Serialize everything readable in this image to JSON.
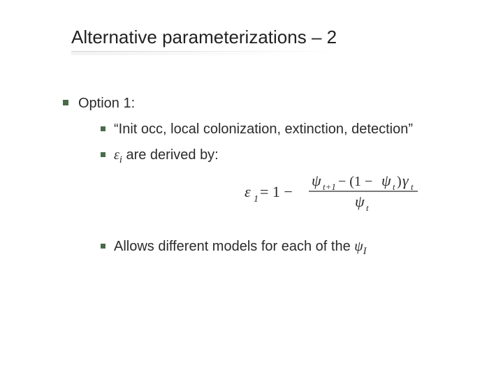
{
  "slide": {
    "title": "Alternative parameterizations – 2",
    "option": {
      "heading": "Option 1:",
      "sub1": "“Init occ, local colonization, extinction, detection”",
      "sub2_prefix": "ε",
      "sub2_sub": "i",
      "sub2_rest": " are derived by:",
      "sub3_prefix": "Allows different models for each of the ",
      "sub3_sym": "ψ",
      "sub3_sub": "I"
    },
    "equation": {
      "eps": "ε",
      "eps_sub": "1",
      "eq": " = 1 − ",
      "num_psi": "ψ",
      "num_psi_sub": "t+1",
      "num_minus": " − (1 − ",
      "num_psi2": "ψ",
      "num_psi2_sub": "t",
      "num_close": ")",
      "num_gamma": "γ",
      "num_gamma_sub": "t",
      "den_psi": "ψ",
      "den_psi_sub": "t"
    }
  }
}
